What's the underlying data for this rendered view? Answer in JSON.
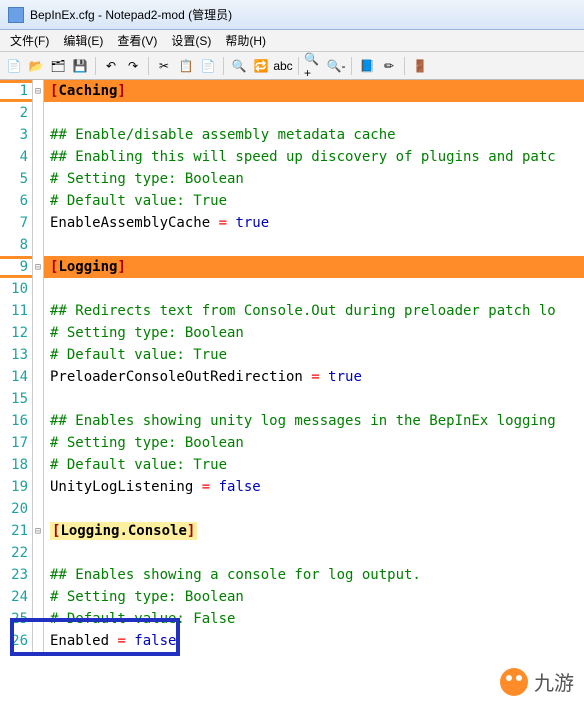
{
  "window": {
    "title": "BepInEx.cfg - Notepad2-mod (管理员)"
  },
  "menu": {
    "file": "文件(F)",
    "edit": "编辑(E)",
    "view": "查看(V)",
    "settings": "设置(S)",
    "help": "帮助(H)"
  },
  "icons": {
    "new": "📄",
    "open": "📂",
    "browse": "🗂",
    "save": "💾",
    "undo": "↶",
    "redo": "↷",
    "cut": "✂",
    "copy": "📋",
    "paste": "📄",
    "find": "🔍",
    "replace": "🔁",
    "word": "abc",
    "zoomin": "🔍+",
    "zoomout": "🔍-",
    "scheme": "📘",
    "custom": "✏",
    "exit": "🚪"
  },
  "lines": [
    {
      "n": 1,
      "fold": "⊟",
      "type": "section",
      "text": "[Caching]"
    },
    {
      "n": 2,
      "type": "blank",
      "text": ""
    },
    {
      "n": 3,
      "type": "comment",
      "text": "## Enable/disable assembly metadata cache"
    },
    {
      "n": 4,
      "type": "comment",
      "text": "## Enabling this will speed up discovery of plugins and patc"
    },
    {
      "n": 5,
      "type": "comment",
      "text": "# Setting type: Boolean"
    },
    {
      "n": 6,
      "type": "comment",
      "text": "# Default value: True"
    },
    {
      "n": 7,
      "type": "kv",
      "key": "EnableAssemblyCache",
      "val": "true"
    },
    {
      "n": 8,
      "type": "blank",
      "text": ""
    },
    {
      "n": 9,
      "fold": "⊟",
      "type": "section",
      "text": "[Logging]"
    },
    {
      "n": 10,
      "type": "blank",
      "text": ""
    },
    {
      "n": 11,
      "type": "comment",
      "text": "## Redirects text from Console.Out during preloader patch lo"
    },
    {
      "n": 12,
      "type": "comment",
      "text": "# Setting type: Boolean"
    },
    {
      "n": 13,
      "type": "comment",
      "text": "# Default value: True"
    },
    {
      "n": 14,
      "type": "kv",
      "key": "PreloaderConsoleOutRedirection",
      "val": "true"
    },
    {
      "n": 15,
      "type": "blank",
      "text": ""
    },
    {
      "n": 16,
      "type": "comment",
      "text": "## Enables showing unity log messages in the BepInEx logging"
    },
    {
      "n": 17,
      "type": "comment",
      "text": "# Setting type: Boolean"
    },
    {
      "n": 18,
      "type": "comment",
      "text": "# Default value: True"
    },
    {
      "n": 19,
      "type": "kv",
      "key": "UnityLogListening",
      "val": "false"
    },
    {
      "n": 20,
      "type": "blank",
      "text": ""
    },
    {
      "n": 21,
      "fold": "⊟",
      "type": "section",
      "hl": true,
      "text": "[Logging.Console]"
    },
    {
      "n": 22,
      "type": "blank",
      "text": ""
    },
    {
      "n": 23,
      "type": "comment",
      "text": "## Enables showing a console for log output."
    },
    {
      "n": 24,
      "type": "comment",
      "text": "# Setting type: Boolean"
    },
    {
      "n": 25,
      "type": "comment-partial",
      "pre": "# Default value: ",
      "rest": "False"
    },
    {
      "n": 26,
      "type": "kv",
      "key": "Enabled",
      "val": "false"
    }
  ],
  "watermark": {
    "text": "九游"
  }
}
